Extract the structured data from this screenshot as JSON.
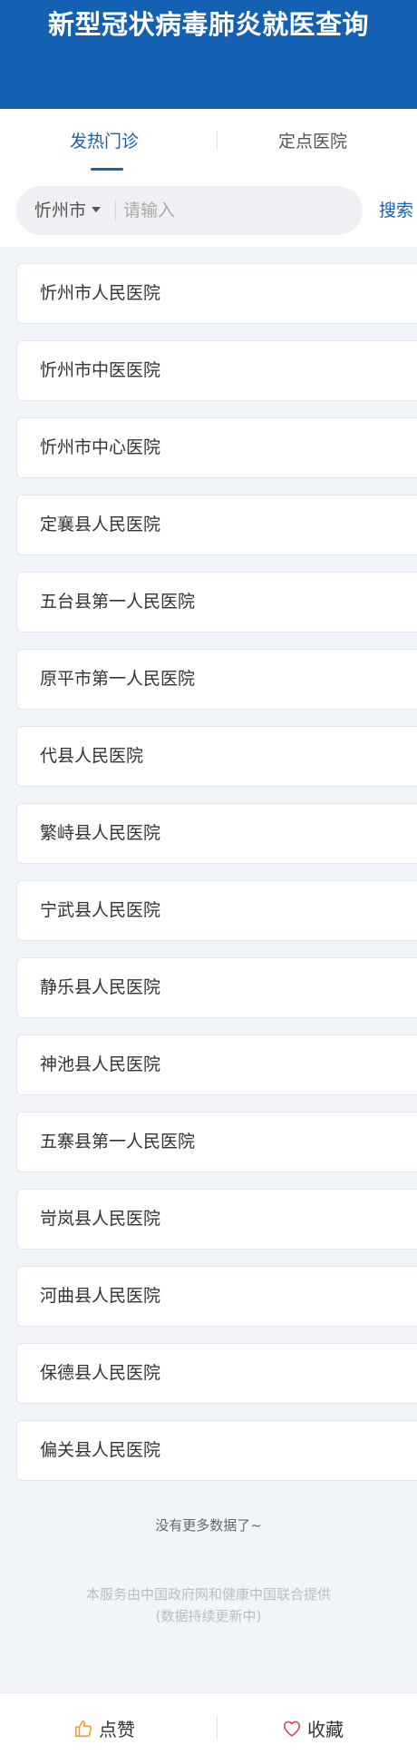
{
  "header": {
    "title": "新型冠状病毒肺炎就医查询"
  },
  "tabs": [
    {
      "label": "发热门诊",
      "active": true
    },
    {
      "label": "定点医院",
      "active": false
    }
  ],
  "search": {
    "city": "忻州市",
    "placeholder": "请输入",
    "value": "",
    "button_label": "搜索"
  },
  "hospitals": [
    "忻州市人民医院",
    "忻州市中医医院",
    "忻州市中心医院",
    "定襄县人民医院",
    "五台县第一人民医院",
    "原平市第一人民医院",
    "代县人民医院",
    "繁峙县人民医院",
    "宁武县人民医院",
    "静乐县人民医院",
    "神池县人民医院",
    "五寨县第一人民医院",
    "岢岚县人民医院",
    "河曲县人民医院",
    "保德县人民医院",
    "偏关县人民医院"
  ],
  "footer": {
    "no_more": "没有更多数据了~",
    "provider_line1": "本服务由中国政府网和健康中国联合提供",
    "provider_line2": "(数据持续更新中)"
  },
  "bottom_bar": {
    "like_label": "点赞",
    "like_icon": "thumbs-up-icon",
    "favorite_label": "收藏",
    "favorite_icon": "heart-icon"
  },
  "colors": {
    "brand": "#1461b3",
    "like_icon": "#f0a430",
    "favorite_icon": "#e0474c"
  }
}
